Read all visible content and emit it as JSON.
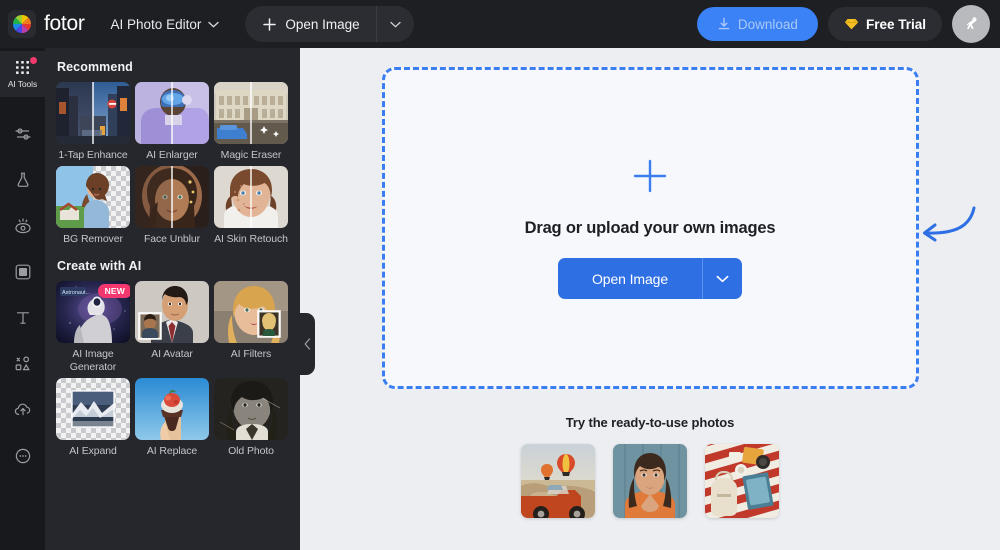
{
  "app": {
    "brand": "fotor",
    "mode_label": "AI Photo Editor"
  },
  "topbar": {
    "open_image_label": "Open Image",
    "download_label": "Download",
    "free_trial_label": "Free Trial",
    "icons": {
      "plus": "plus-icon",
      "chevron_down": "chevron-down-icon",
      "download": "download-icon",
      "diamond": "diamond-icon",
      "avatar": "bird-avatar-icon"
    }
  },
  "rail": {
    "items": [
      {
        "label": "AI Tools",
        "icon": "grid-dots-icon",
        "active": true,
        "badge": true
      },
      {
        "label": "",
        "icon": "adjust-sliders-icon",
        "active": false,
        "badge": false
      },
      {
        "label": "",
        "icon": "flask-icon",
        "active": false,
        "badge": false
      },
      {
        "label": "",
        "icon": "retouch-eye-icon",
        "active": false,
        "badge": false
      },
      {
        "label": "",
        "icon": "frame-icon",
        "active": false,
        "badge": false
      },
      {
        "label": "",
        "icon": "text-icon",
        "active": false,
        "badge": false
      },
      {
        "label": "",
        "icon": "elements-icon",
        "active": false,
        "badge": false
      },
      {
        "label": "",
        "icon": "upload-cloud-icon",
        "active": false,
        "badge": false
      },
      {
        "label": "",
        "icon": "more-icon",
        "active": false,
        "badge": false
      }
    ]
  },
  "panel": {
    "sections": [
      {
        "title": "Recommend",
        "tiles": [
          {
            "label": "1-Tap Enhance",
            "thumb": "street-before-after",
            "badge": ""
          },
          {
            "label": "AI Enlarger",
            "thumb": "skier-before-after",
            "badge": ""
          },
          {
            "label": "Magic Eraser",
            "thumb": "building-car-before-after",
            "badge": ""
          },
          {
            "label": "BG Remover",
            "thumb": "woman-bg-removed",
            "badge": ""
          },
          {
            "label": "Face Unblur",
            "thumb": "face-blur-before-after",
            "badge": ""
          },
          {
            "label": "AI Skin Retouch",
            "thumb": "skin-retouch-before-after",
            "badge": ""
          }
        ]
      },
      {
        "title": "Create with AI",
        "tiles": [
          {
            "label": "AI Image Generator",
            "thumb": "astronaut-horse-space",
            "badge": "NEW"
          },
          {
            "label": "AI Avatar",
            "thumb": "man-suit-avatar",
            "badge": ""
          },
          {
            "label": "AI Filters",
            "thumb": "blonde-woman-filter",
            "badge": ""
          },
          {
            "label": "AI Expand",
            "thumb": "mountain-expand",
            "badge": ""
          },
          {
            "label": "AI Replace",
            "thumb": "ice-cream-sky",
            "badge": ""
          },
          {
            "label": "Old Photo",
            "thumb": "old-photo-portrait",
            "badge": ""
          }
        ]
      }
    ],
    "collapse_icon": "chevron-left-icon"
  },
  "canvas": {
    "dropzone": {
      "plus_icon": "plus-icon",
      "prompt": "Drag or upload your own images",
      "open_image_label": "Open Image",
      "caret_icon": "chevron-down-icon",
      "arrow_icon": "curved-arrow-icon"
    },
    "ready": {
      "title": "Try the ready-to-use photos",
      "photos": [
        {
          "name": "hot-air-balloons-car"
        },
        {
          "name": "woman-portrait-orange"
        },
        {
          "name": "picnic-blanket-flatlay"
        }
      ]
    }
  },
  "colors": {
    "accent_blue": "#2f6fe4",
    "dropzone_border": "#3b7ef2",
    "badge_pink": "#f5376f",
    "notify_red": "#f23b6c",
    "topbar_bg": "#1e1f23",
    "panel_bg": "#26272c",
    "rail_bg": "#18191d",
    "canvas_bg": "#eceef1"
  }
}
